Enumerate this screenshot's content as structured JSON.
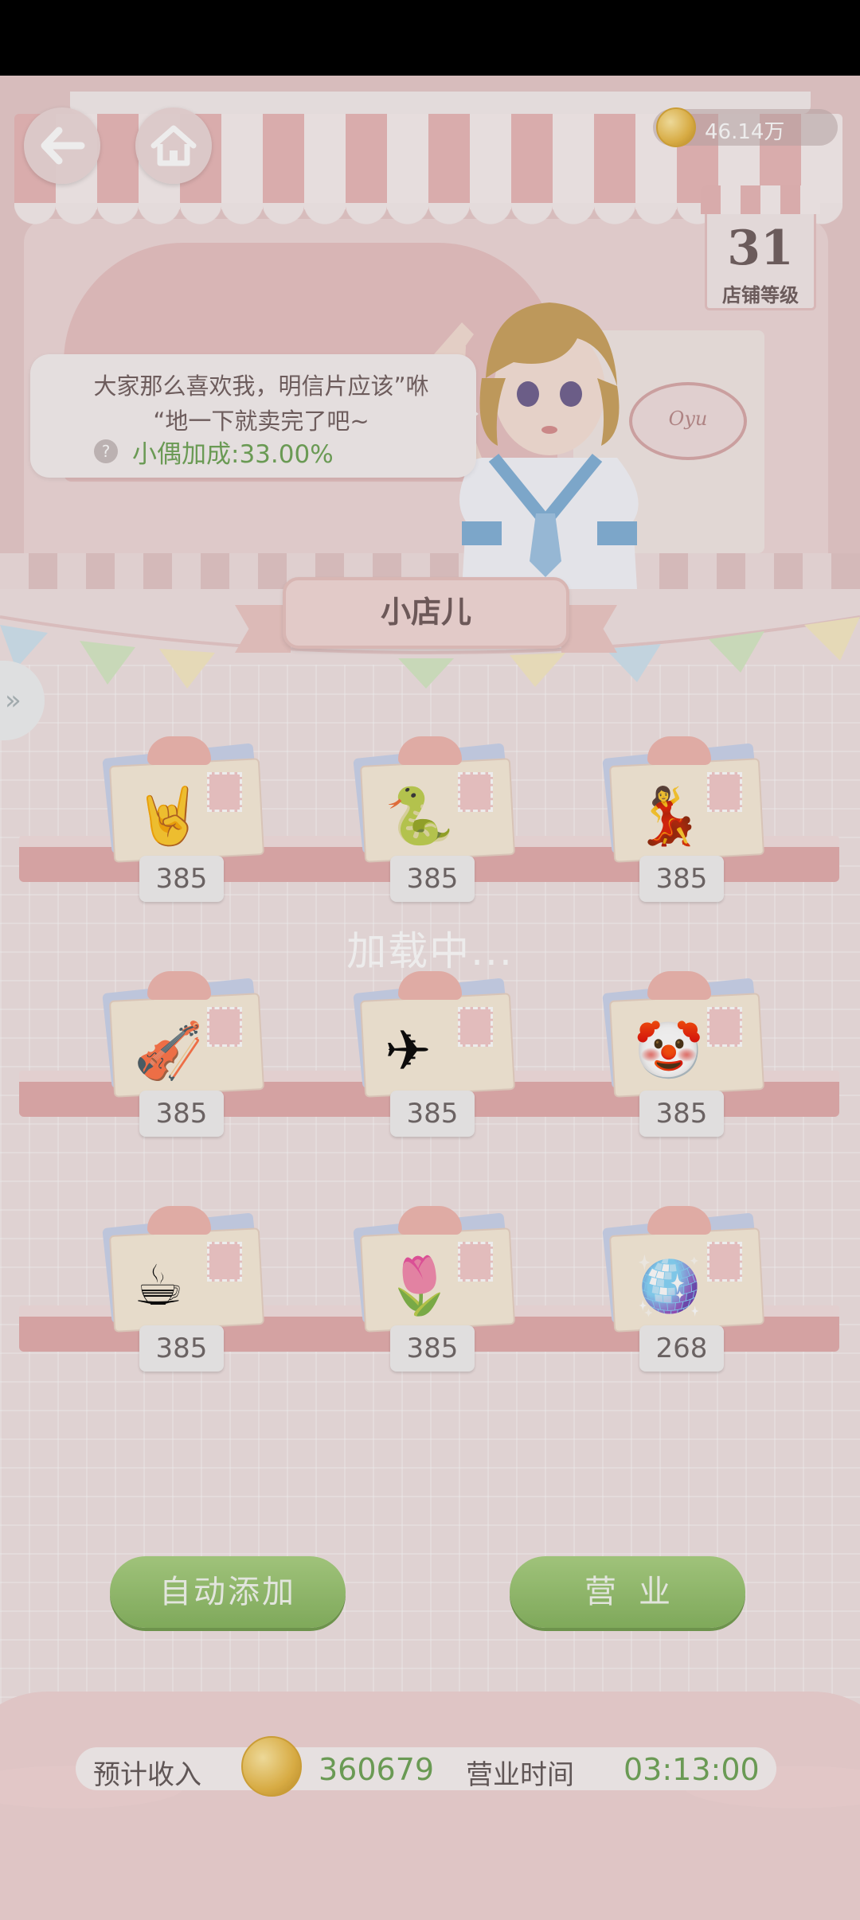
{
  "header": {
    "coins": "46.14万",
    "shop_level": "31",
    "shop_level_label": "店铺等级",
    "store_sign": "Oyu"
  },
  "dialogue": {
    "line1": "大家那么喜欢我，明信片应该”咻",
    "line2": "“地一下就卖完了吧~",
    "bonus": "小偶加成:33.00%"
  },
  "shop_title": "小店儿",
  "loading": "加载中...",
  "items": [
    {
      "icon": "rock-hand-icon",
      "price": "385"
    },
    {
      "icon": "snake-flute-icon",
      "price": "385"
    },
    {
      "icon": "dancer-doll-icon",
      "price": "385"
    },
    {
      "icon": "violin-icon",
      "price": "385"
    },
    {
      "icon": "airplane-microscope-icon",
      "price": "385"
    },
    {
      "icon": "clown-box-icon",
      "price": "385"
    },
    {
      "icon": "teacup-cake-icon",
      "price": "385"
    },
    {
      "icon": "watering-can-icon",
      "price": "385"
    },
    {
      "icon": "disco-ball-icon",
      "price": "268"
    }
  ],
  "buttons": {
    "auto_add": "自动添加",
    "open_business": "营业"
  },
  "footer": {
    "income_label": "预计收入",
    "income_value": "360679",
    "time_label": "营业时间",
    "time_value": "03:13:00"
  },
  "colors": {
    "accent_green": "#6aa253",
    "button_green": "#8fbf63",
    "awning_pink": "#e9b7b7",
    "shelf_pink": "#e3abab"
  }
}
